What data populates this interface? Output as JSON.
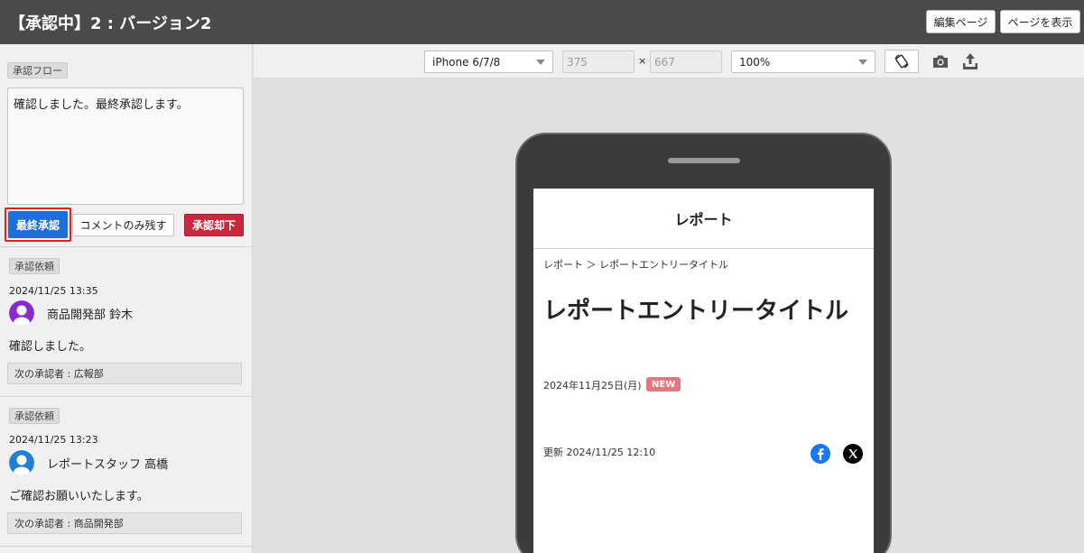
{
  "header": {
    "title": "【承認中】2 : バージョン2",
    "edit_page_label": "編集ページ",
    "view_page_label": "ページを表示"
  },
  "sidebar": {
    "flow_tag": "承認フロー",
    "comment_value": "確認しました。最終承認します。",
    "final_approve_label": "最終承認",
    "comment_only_label": "コメントのみ残す",
    "reject_label": "承認却下",
    "requests": [
      {
        "tag": "承認依頼",
        "datetime": "2024/11/25 13:35",
        "user": "商品開発部 鈴木",
        "avatar_color": "#8a2bc9",
        "message": "確認しました。",
        "next_approver": "次の承認者 : 広報部"
      },
      {
        "tag": "承認依頼",
        "datetime": "2024/11/25 13:23",
        "user": "レポートスタッフ 高橋",
        "avatar_color": "#1f7fd6",
        "message": "ご確認お願いいたします。",
        "next_approver": "次の承認者 : 商品開発部"
      }
    ]
  },
  "toolbar": {
    "device_selected": "iPhone 6/7/8",
    "width_value": "375",
    "times_sign": "×",
    "height_value": "667",
    "zoom_selected": "100%",
    "icons": [
      "rotate-icon",
      "camera-icon",
      "upload-icon"
    ]
  },
  "preview": {
    "site_title": "レポート",
    "breadcrumb": "レポート ＞ レポートエントリータイトル",
    "article_title": "レポートエントリータイトル",
    "article_date": "2024年11月25日(月)",
    "new_badge": "NEW",
    "updated": "更新 2024/11/25 12:10",
    "social_icons": [
      "facebook-icon",
      "x-icon"
    ],
    "facebook_color": "#1877f2"
  }
}
